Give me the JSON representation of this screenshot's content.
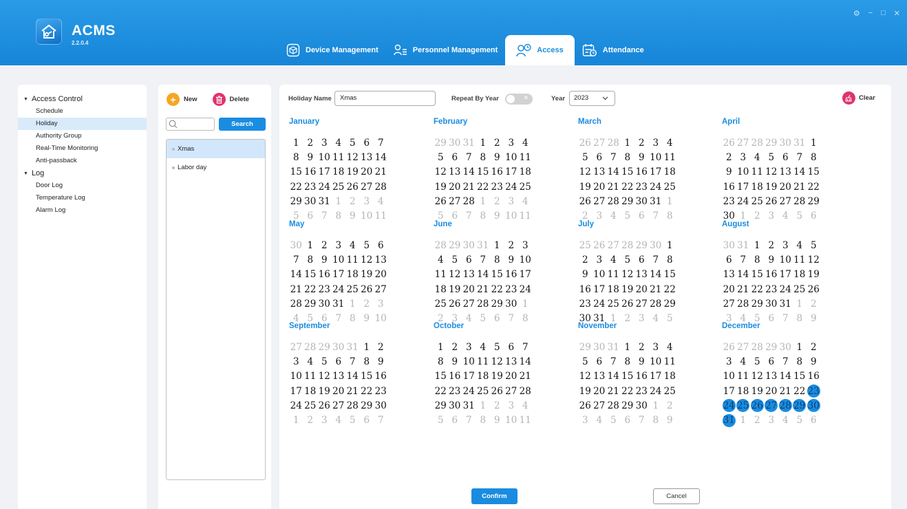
{
  "app": {
    "title": "ACMS",
    "version": "2.2.0.4"
  },
  "window_controls": [
    "⚙",
    "−",
    "□",
    "✕"
  ],
  "nav": [
    {
      "label": "Device Management",
      "icon": "device-icon",
      "active": false
    },
    {
      "label": "Personnel Management",
      "icon": "personnel-icon",
      "active": false
    },
    {
      "label": "Access",
      "icon": "access-icon",
      "active": true
    },
    {
      "label": "Attendance",
      "icon": "attendance-icon",
      "active": false
    }
  ],
  "sidebar": {
    "groups": [
      {
        "label": "Access Control",
        "items": [
          {
            "label": "Schedule",
            "active": false
          },
          {
            "label": "Holiday",
            "active": true
          },
          {
            "label": "Authority Group",
            "active": false
          },
          {
            "label": "Real-Time Monitoring",
            "active": false
          },
          {
            "label": "Anti-passback",
            "active": false
          }
        ]
      },
      {
        "label": "Log",
        "items": [
          {
            "label": "Door Log",
            "active": false
          },
          {
            "label": "Temperature Log",
            "active": false
          },
          {
            "label": "Alarm Log",
            "active": false
          }
        ]
      }
    ]
  },
  "list_panel": {
    "new_label": "New",
    "delete_label": "Delete",
    "search_value": "",
    "search_button": "Search",
    "items": [
      {
        "label": "Xmas",
        "selected": true
      },
      {
        "label": "Labor day",
        "selected": false
      }
    ]
  },
  "form": {
    "holiday_name_label": "Holiday Name",
    "holiday_name_value": "Xmas",
    "repeat_label": "Repeat By Year",
    "repeat_on": false,
    "year_label": "Year",
    "year_value": "2023",
    "clear_label": "Clear"
  },
  "calendar": {
    "year": 2023,
    "week_start": "Sunday",
    "months": [
      "January",
      "February",
      "March",
      "April",
      "May",
      "June",
      "July",
      "August",
      "September",
      "October",
      "November",
      "December"
    ],
    "selected": [
      {
        "month": 12,
        "days": [
          23,
          24,
          25,
          26,
          27,
          28,
          29,
          30,
          31
        ]
      }
    ]
  },
  "actions": {
    "confirm": "Confirm",
    "cancel": "Cancel"
  },
  "colors": {
    "accent": "#1a8ce0",
    "header": "#1e8fdf",
    "delete": "#e0336c",
    "new": "#f5a623"
  }
}
